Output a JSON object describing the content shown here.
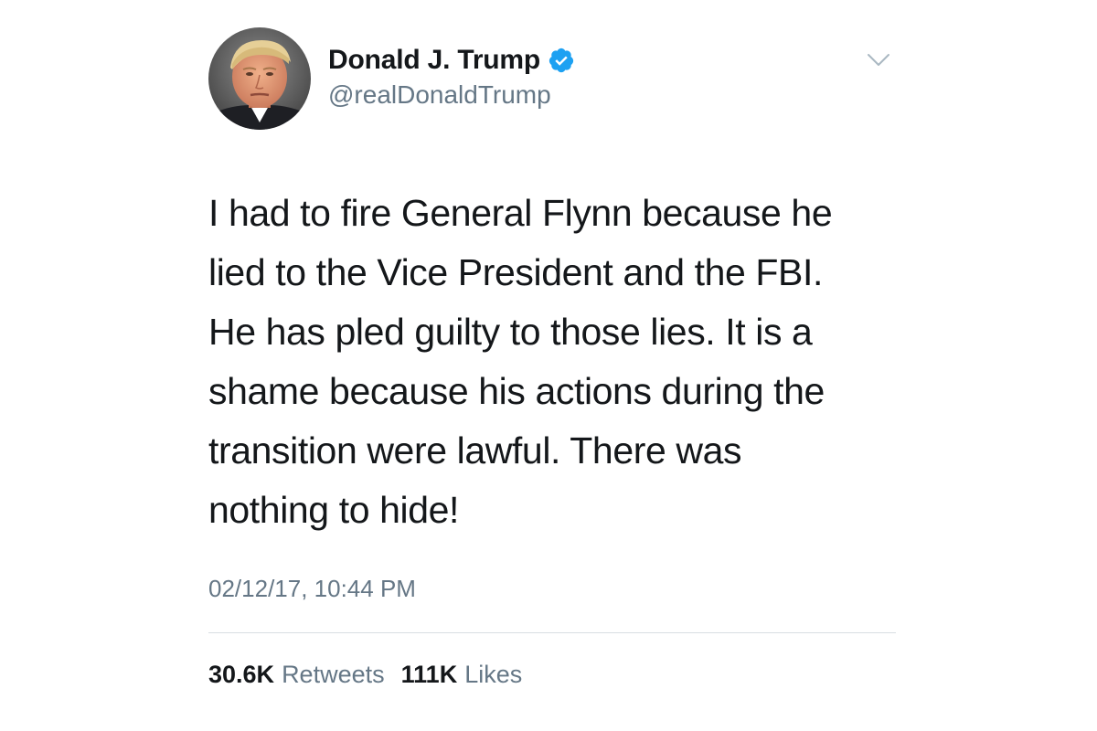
{
  "user": {
    "display_name": "Donald J. Trump",
    "handle": "@realDonaldTrump",
    "verified": true,
    "avatar_icon": "profile-photo"
  },
  "tweet": {
    "text": "I had to fire General Flynn because he\nlied to the Vice President and the FBI.\nHe has pled guilty to those lies. It is a\nshame because his actions during the\ntransition were lawful. There was\nnothing to hide!",
    "timestamp": "02/12/17, 10:44 PM"
  },
  "stats": {
    "retweets_count": "30.6K",
    "retweets_label": "Retweets",
    "likes_count": "111K",
    "likes_label": "Likes"
  },
  "icons": {
    "verified": "verified-badge-icon",
    "menu": "chevron-down-icon"
  },
  "colors": {
    "text_primary": "#14171a",
    "text_secondary": "#657786",
    "verified_blue": "#1da1f2",
    "divider": "#d9dee2"
  }
}
